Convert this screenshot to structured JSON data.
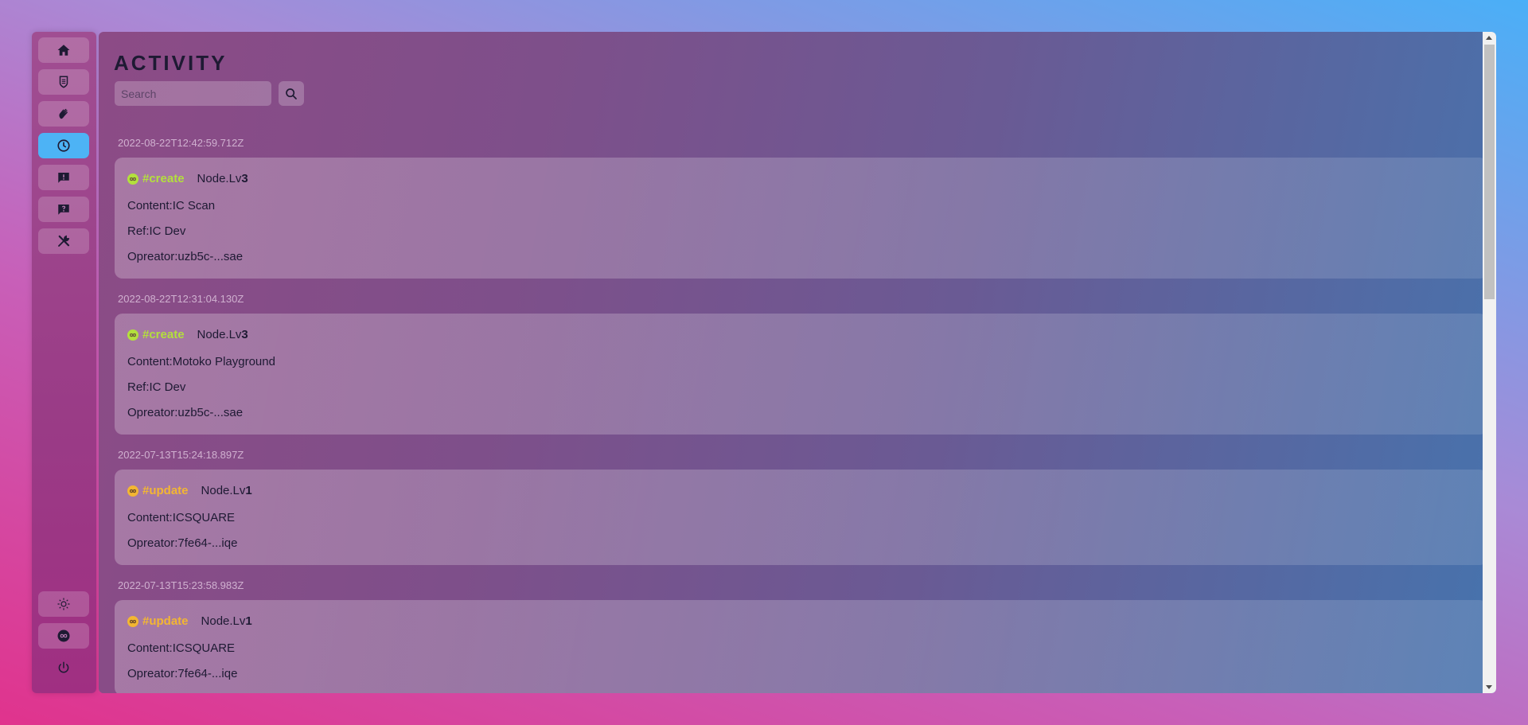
{
  "sidebar": {
    "top_items": [
      {
        "icon": "home-icon",
        "active": false
      },
      {
        "icon": "shield-icon",
        "active": false
      },
      {
        "icon": "wave-hand-icon",
        "active": false
      },
      {
        "icon": "clock-icon",
        "active": true
      },
      {
        "icon": "report-icon",
        "active": false
      },
      {
        "icon": "question-icon",
        "active": false
      },
      {
        "icon": "tools-icon",
        "active": false
      }
    ],
    "bottom_items": [
      {
        "icon": "sun-icon"
      },
      {
        "icon": "infinity-icon"
      },
      {
        "icon": "power-icon"
      }
    ],
    "active_color": "#4db3f5"
  },
  "page": {
    "title": "ACTIVITY",
    "search": {
      "placeholder": "Search",
      "value": ""
    }
  },
  "activities": [
    {
      "timestamp": "2022-08-22T12:42:59.712Z",
      "type": "create",
      "tag": "#create",
      "node_prefix": "Node.Lv",
      "node_level": "3",
      "lines": [
        "Content:IC Scan",
        "Ref:IC Dev",
        "Opreator:uzb5c-...sae"
      ]
    },
    {
      "timestamp": "2022-08-22T12:31:04.130Z",
      "type": "create",
      "tag": "#create",
      "node_prefix": "Node.Lv",
      "node_level": "3",
      "lines": [
        "Content:Motoko Playground",
        "Ref:IC Dev",
        "Opreator:uzb5c-...sae"
      ]
    },
    {
      "timestamp": "2022-07-13T15:24:18.897Z",
      "type": "update",
      "tag": "#update",
      "node_prefix": "Node.Lv",
      "node_level": "1",
      "lines": [
        "Content:ICSQUARE",
        "Opreator:7fe64-...iqe"
      ]
    },
    {
      "timestamp": "2022-07-13T15:23:58.983Z",
      "type": "update",
      "tag": "#update",
      "node_prefix": "Node.Lv",
      "node_level": "1",
      "lines": [
        "Content:ICSQUARE",
        "Opreator:7fe64-...iqe"
      ]
    }
  ],
  "colors": {
    "create": "#b3e03c",
    "update": "#f3b632"
  }
}
